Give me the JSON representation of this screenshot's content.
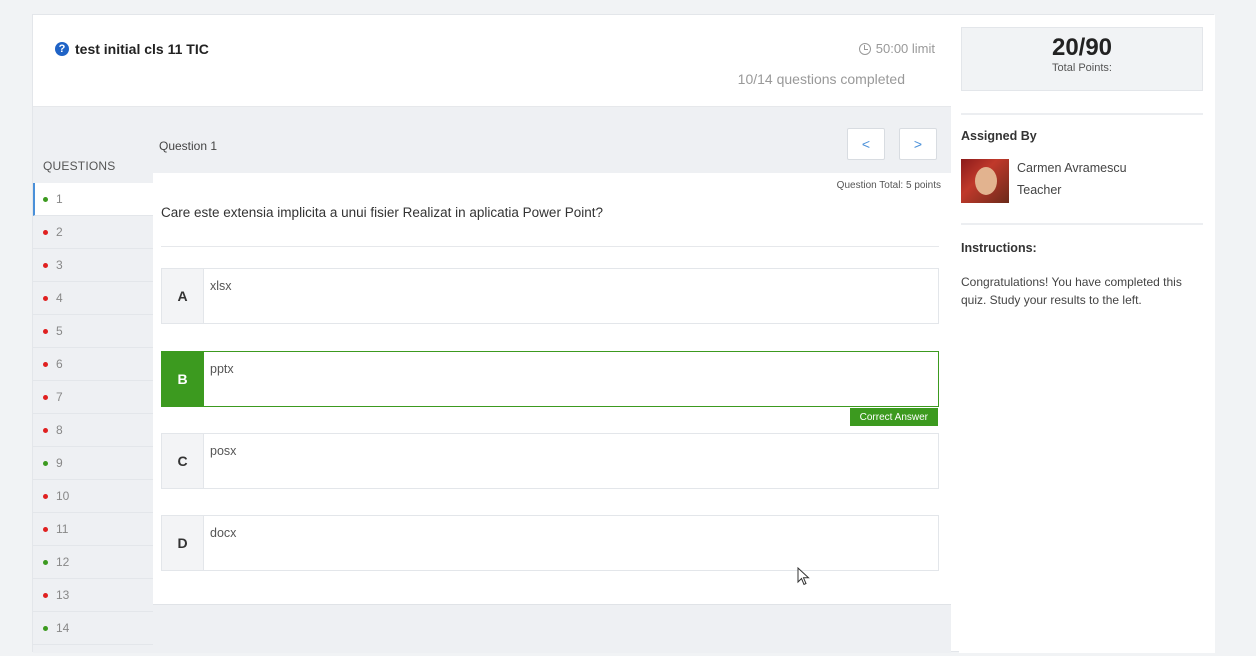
{
  "header": {
    "title": "test initial cls 11 TIC",
    "time_limit": "50:00 limit",
    "progress": "10/14 questions completed"
  },
  "sidebar": {
    "heading": "QUESTIONS",
    "items": [
      {
        "label": "1",
        "status": "correct"
      },
      {
        "label": "2",
        "status": "wrong"
      },
      {
        "label": "3",
        "status": "wrong"
      },
      {
        "label": "4",
        "status": "wrong"
      },
      {
        "label": "5",
        "status": "wrong"
      },
      {
        "label": "6",
        "status": "wrong"
      },
      {
        "label": "7",
        "status": "wrong"
      },
      {
        "label": "8",
        "status": "wrong"
      },
      {
        "label": "9",
        "status": "correct"
      },
      {
        "label": "10",
        "status": "wrong"
      },
      {
        "label": "11",
        "status": "wrong"
      },
      {
        "label": "12",
        "status": "correct"
      },
      {
        "label": "13",
        "status": "wrong"
      },
      {
        "label": "14",
        "status": "correct"
      }
    ]
  },
  "question": {
    "label": "Question 1",
    "prev_label": "<",
    "next_label": ">",
    "total": "Question Total: 5 points",
    "text": "Care este extensia implicita a unui fisier Realizat in aplicatia Power Point?",
    "options": [
      {
        "letter": "A",
        "text": "xlsx"
      },
      {
        "letter": "B",
        "text": "pptx"
      },
      {
        "letter": "C",
        "text": "posx"
      },
      {
        "letter": "D",
        "text": "docx"
      }
    ],
    "correct_badge": "Correct Answer"
  },
  "right": {
    "points_value": "20/90",
    "points_label": "Total Points:",
    "assigned_by_title": "Assigned By",
    "teacher_name": "Carmen Avramescu",
    "teacher_role": "Teacher",
    "instructions_title": "Instructions:",
    "instructions_text": "Congratulations! You have completed this quiz. Study your results to the left."
  },
  "colors": {
    "correct": "#3c9a1f",
    "wrong": "#e02020",
    "accent": "#4a90d9"
  }
}
